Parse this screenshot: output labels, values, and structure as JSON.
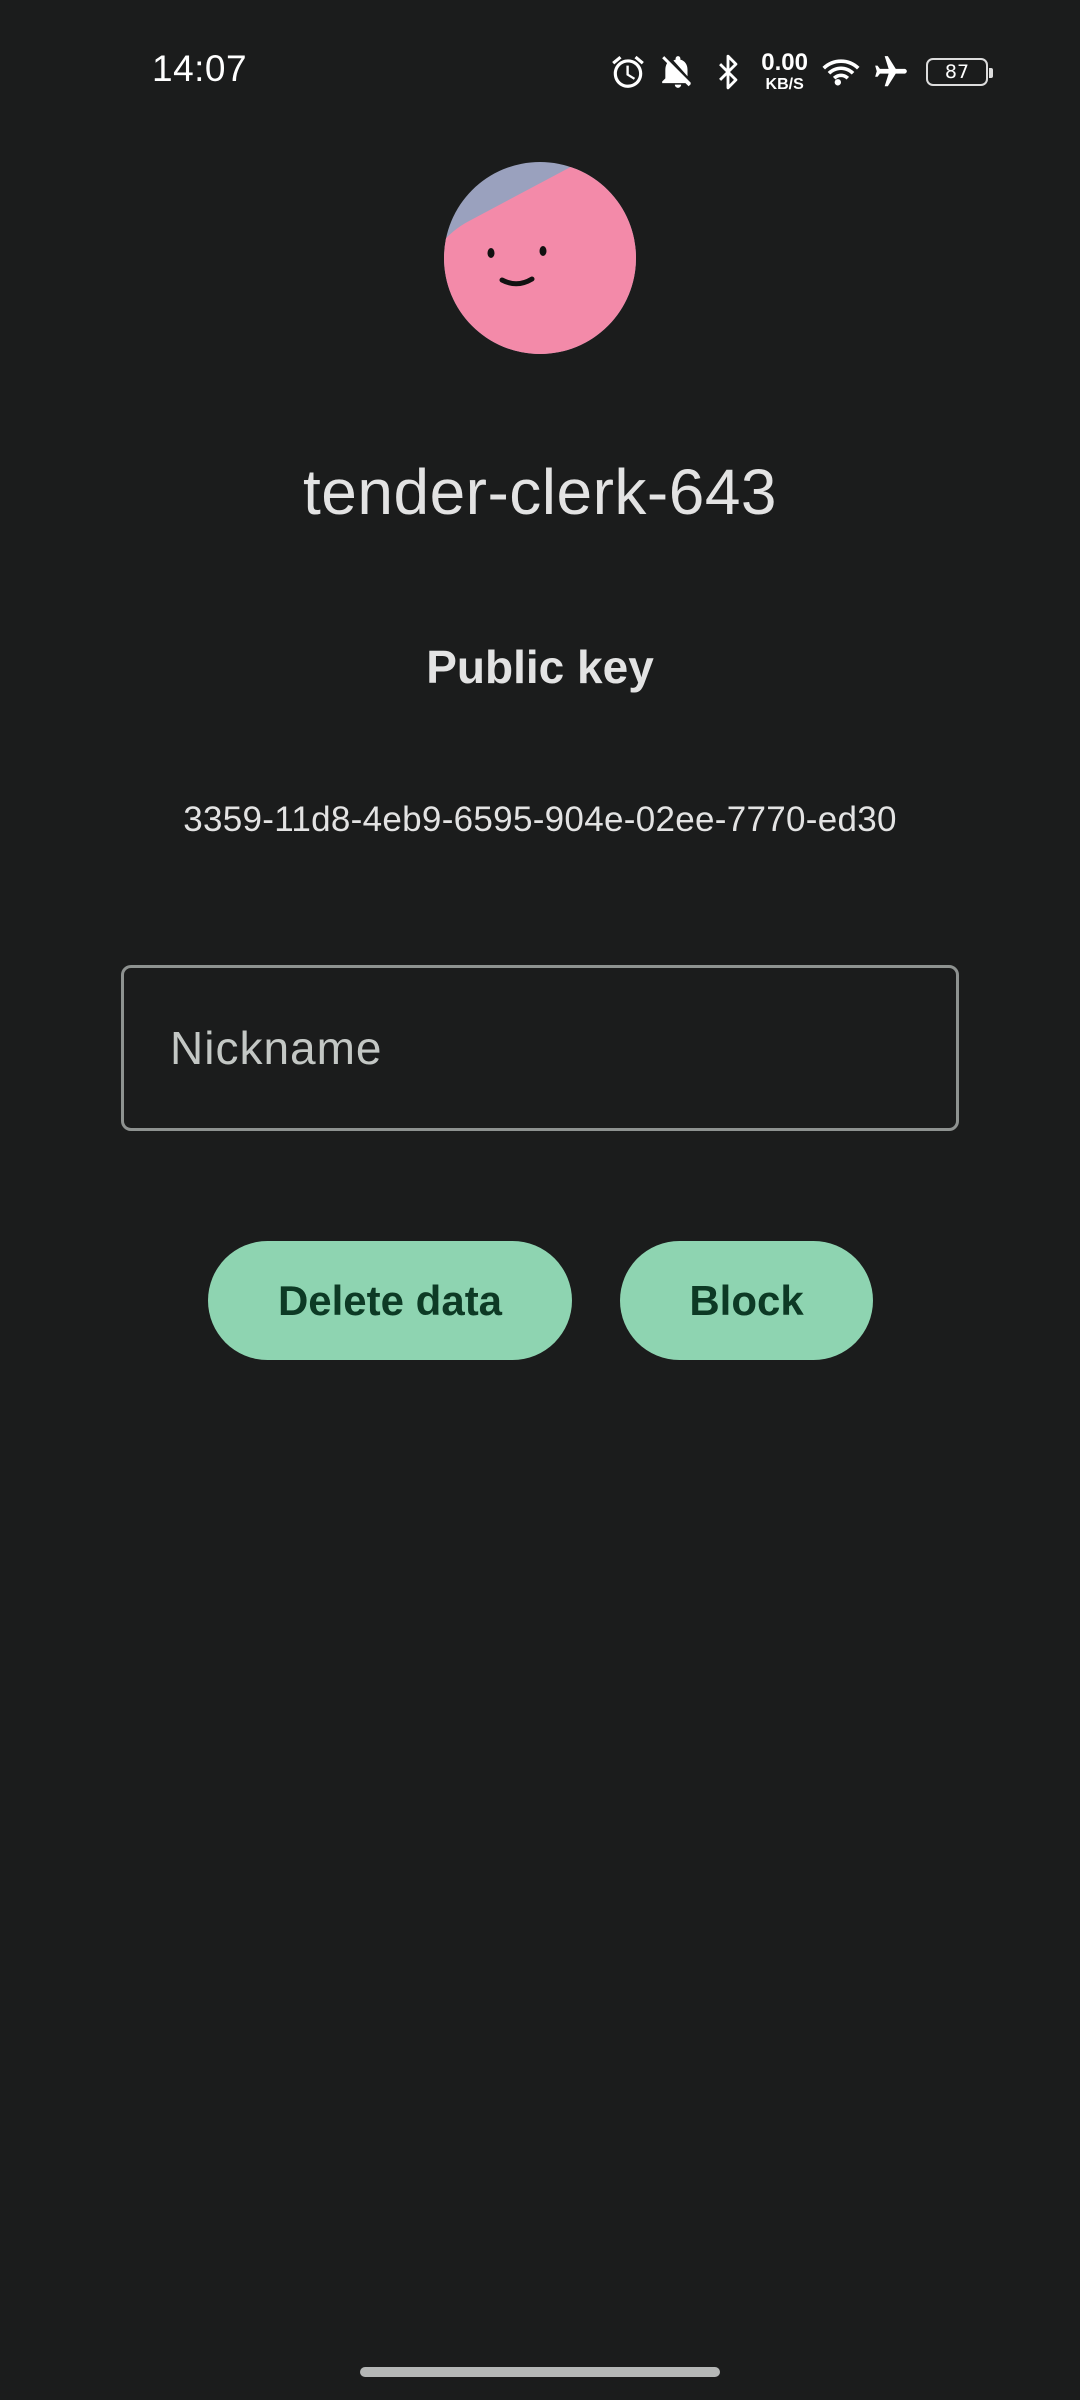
{
  "status_bar": {
    "time": "14:07",
    "net_speed_value": "0.00",
    "net_speed_unit": "KB/S",
    "battery_level": "87",
    "icons": [
      "alarm-icon",
      "bell-off-icon",
      "bluetooth-icon",
      "wifi-icon",
      "airplane-mode-icon",
      "battery-icon"
    ]
  },
  "profile": {
    "avatar_icon": "smiley-avatar-icon",
    "avatar_colors": {
      "face": "#f38aa9",
      "background": "#9aa1be"
    },
    "display_name": "tender-clerk-643",
    "key_heading": "Public key",
    "key_value": "3359-11d8-4eb9-6595-904e-02ee-7770-ed30"
  },
  "nickname": {
    "placeholder": "Nickname",
    "value": ""
  },
  "actions": {
    "delete_label": "Delete data",
    "block_label": "Block"
  },
  "colors": {
    "background": "#1b1c1c",
    "button_fill": "#8ed4b1",
    "button_text": "#0d3a25",
    "field_border": "#8e9290",
    "text": "#e3e3e3"
  }
}
